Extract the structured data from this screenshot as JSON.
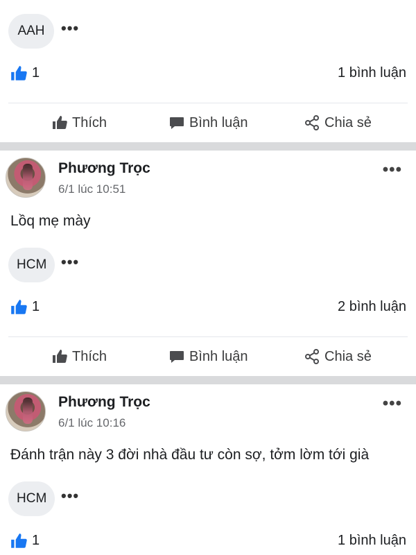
{
  "post0": {
    "tag": "AAH",
    "more": "•••",
    "likes": "1",
    "comments": "1 bình luận",
    "actions": {
      "like": "Thích",
      "comment": "Bình luận",
      "share": "Chia sẻ"
    }
  },
  "post1": {
    "author": "Phương Trọc",
    "time": "6/1 lúc 10:51",
    "more": "•••",
    "content": "Lồq mẹ mày",
    "tag": "HCM",
    "tag_more": "•••",
    "likes": "1",
    "comments": "2 bình luận",
    "actions": {
      "like": "Thích",
      "comment": "Bình luận",
      "share": "Chia sẻ"
    }
  },
  "post2": {
    "author": "Phương Trọc",
    "time": "6/1 lúc 10:16",
    "more": "•••",
    "content": "Đánh trận này 3 đời nhà đầu tư còn sợ, tởm lờm tới già",
    "tag": "HCM",
    "tag_more": "•••",
    "likes": "1",
    "comments": "1 bình luận"
  },
  "colors": {
    "like_blue": "#1877f2",
    "separator": "#d9dadc",
    "secondary_text": "#65676b"
  }
}
